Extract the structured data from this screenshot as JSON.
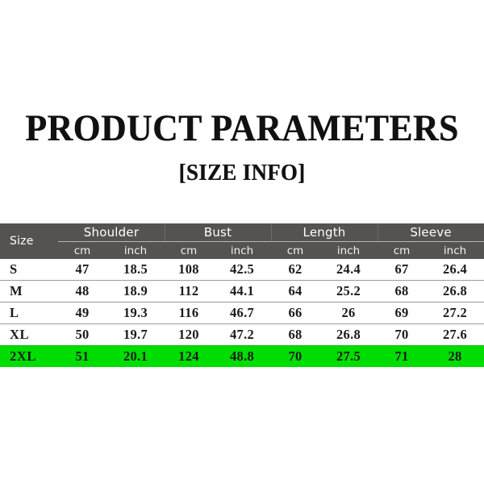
{
  "document": {
    "title": "PRODUCT PARAMETERS",
    "subtitle": "[SIZE INFO]"
  },
  "colors": {
    "background": "#ffffff",
    "header_band": "#555352",
    "header_text": "#ffffff",
    "body_text": "#1a1a1a",
    "row_divider": "#9d9b99",
    "highlight_row": "#00dd00"
  },
  "table": {
    "size_column_label": "Size",
    "groups": [
      {
        "label": "Shoulder",
        "units": [
          "cm",
          "inch"
        ]
      },
      {
        "label": "Bust",
        "units": [
          "cm",
          "inch"
        ]
      },
      {
        "label": "Length",
        "units": [
          "cm",
          "inch"
        ]
      },
      {
        "label": "Sleeve",
        "units": [
          "cm",
          "inch"
        ]
      }
    ],
    "columns": [
      "Size",
      "cm",
      "inch",
      "cm",
      "inch",
      "cm",
      "inch",
      "cm",
      "inch"
    ],
    "rows": [
      {
        "size": "S",
        "highlighted": false,
        "shoulder_cm": "47",
        "shoulder_inch": "18.5",
        "bust_cm": "108",
        "bust_inch": "42.5",
        "length_cm": "62",
        "length_inch": "24.4",
        "sleeve_cm": "67",
        "sleeve_inch": "26.4"
      },
      {
        "size": "M",
        "highlighted": false,
        "shoulder_cm": "48",
        "shoulder_inch": "18.9",
        "bust_cm": "112",
        "bust_inch": "44.1",
        "length_cm": "64",
        "length_inch": "25.2",
        "sleeve_cm": "68",
        "sleeve_inch": "26.8"
      },
      {
        "size": "L",
        "highlighted": false,
        "shoulder_cm": "49",
        "shoulder_inch": "19.3",
        "bust_cm": "116",
        "bust_inch": "46.7",
        "length_cm": "66",
        "length_inch": "26",
        "sleeve_cm": "69",
        "sleeve_inch": "27.2"
      },
      {
        "size": "XL",
        "highlighted": false,
        "shoulder_cm": "50",
        "shoulder_inch": "19.7",
        "bust_cm": "120",
        "bust_inch": "47.2",
        "length_cm": "68",
        "length_inch": "26.8",
        "sleeve_cm": "70",
        "sleeve_inch": "27.6"
      },
      {
        "size": "2XL",
        "highlighted": true,
        "shoulder_cm": "51",
        "shoulder_inch": "20.1",
        "bust_cm": "124",
        "bust_inch": "48.8",
        "length_cm": "70",
        "length_inch": "27.5",
        "sleeve_cm": "71",
        "sleeve_inch": "28"
      }
    ]
  }
}
